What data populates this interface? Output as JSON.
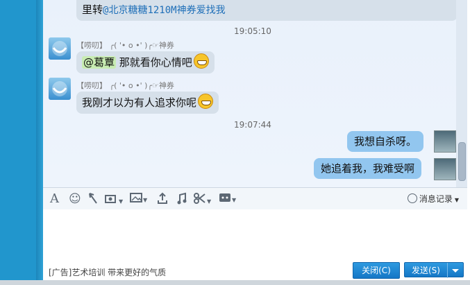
{
  "messages": {
    "top_bubble": {
      "prefix": "里转",
      "mention": "@北京糖糖1210M神券爱找我"
    },
    "time1": "19:05:10",
    "sender1": "【唠叨】 ╭( '• o •' )╭☞神券",
    "msg1_mention": "@葛覃",
    "msg1_text": " 那就看你心情吧",
    "sender2": "【唠叨】 ╭( '• o •' )╭☞神券",
    "msg2_text": "我刚才以为有人追求你呢",
    "time2": "19:07:44",
    "out1": "我想自杀呀。",
    "out2": "她追着我，我难受啊"
  },
  "toolbar": {
    "font_icon": "A",
    "emoji_icon": "☺",
    "history_label": "消息记录"
  },
  "input": {
    "ad_text": "[广告]艺术培训 带来更好的气质",
    "close_label": "关闭(C)",
    "send_label": "发送(S)"
  }
}
